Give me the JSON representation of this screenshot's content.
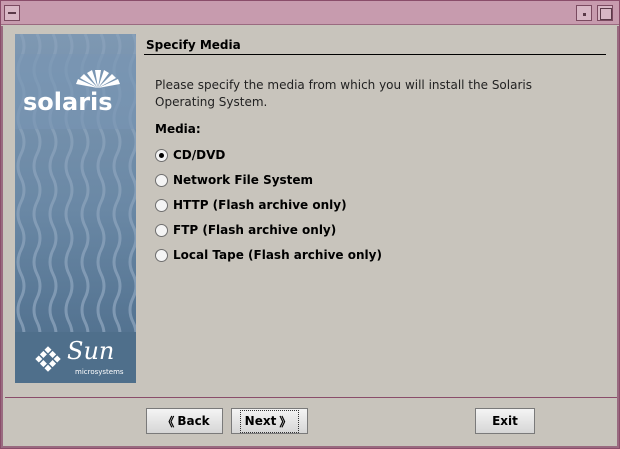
{
  "window": {
    "menu_icon": "window-menu-icon",
    "minimize_icon": "minimize-icon",
    "maximize_icon": "maximize-icon"
  },
  "brand": {
    "product": "solaris",
    "company": "Sun",
    "company_sub": "microsystems",
    "sunburst_icon": "sunburst-icon",
    "sun_logo_icon": "sun-logo-icon"
  },
  "page": {
    "title": "Specify Media",
    "description": "Please specify the media from which you will install the Solaris Operating System.",
    "media_label": "Media:"
  },
  "media_options": [
    {
      "label": "CD/DVD",
      "checked": true
    },
    {
      "label": "Network File System",
      "checked": false
    },
    {
      "label": "HTTP (Flash archive only)",
      "checked": false
    },
    {
      "label": "FTP (Flash archive only)",
      "checked": false
    },
    {
      "label": "Local Tape (Flash archive only)",
      "checked": false
    }
  ],
  "buttons": {
    "back": "Back",
    "next": "Next",
    "exit": "Exit",
    "back_icon": "chevron-left-icon",
    "next_icon": "chevron-right-icon"
  }
}
